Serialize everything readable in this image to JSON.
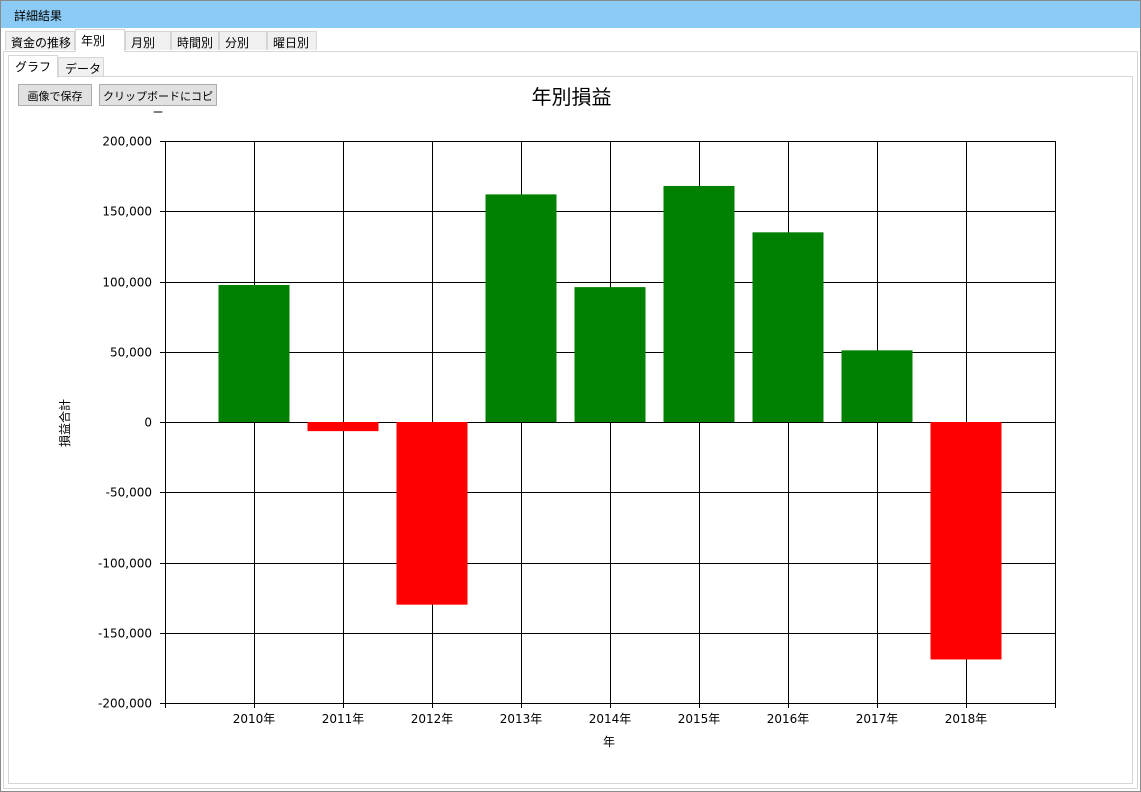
{
  "window": {
    "title": "詳細結果"
  },
  "tabs": [
    {
      "label": "資金の推移"
    },
    {
      "label": "年別"
    },
    {
      "label": "月別"
    },
    {
      "label": "時間別"
    },
    {
      "label": "分別"
    },
    {
      "label": "曜日別"
    }
  ],
  "subtabs": [
    {
      "label": "グラフ"
    },
    {
      "label": "データ"
    }
  ],
  "toolbar": {
    "save_image_label": "画像で保存",
    "copy_clipboard_label": "クリップボードにコピー"
  },
  "colors": {
    "positive": "#008000",
    "negative": "#ff0000",
    "titlebar": "#8ccbf5"
  },
  "chart_data": {
    "type": "bar",
    "title": "年別損益",
    "xlabel": "年",
    "ylabel": "損益合計",
    "categories": [
      "2010年",
      "2011年",
      "2012年",
      "2013年",
      "2014年",
      "2015年",
      "2016年",
      "2017年",
      "2018年"
    ],
    "values": [
      97500,
      -6500,
      -130000,
      162000,
      96000,
      168000,
      135000,
      51000,
      -169000
    ],
    "ylim": [
      -200000,
      200000
    ],
    "yticks": [
      {
        "value": 200000,
        "label": "200,000"
      },
      {
        "value": 150000,
        "label": "150,000"
      },
      {
        "value": 100000,
        "label": "100,000"
      },
      {
        "value": 50000,
        "label": "50,000"
      },
      {
        "value": 0,
        "label": "0"
      },
      {
        "value": -50000,
        "label": "-50,000"
      },
      {
        "value": -100000,
        "label": "-100,000"
      },
      {
        "value": -150000,
        "label": "-150,000"
      },
      {
        "value": -200000,
        "label": "-200,000"
      }
    ],
    "grid": true,
    "legend": "none"
  }
}
